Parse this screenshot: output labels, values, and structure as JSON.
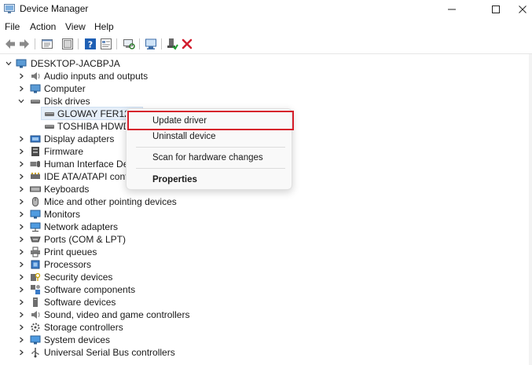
{
  "window": {
    "title": "Device Manager",
    "minimize_icon": "minimize-icon",
    "maximize_icon": "maximize-icon",
    "close_icon": "close-icon"
  },
  "menu": [
    "File",
    "Action",
    "View",
    "Help"
  ],
  "toolbar": {
    "buttons": [
      "back-arrow-icon",
      "forward-arrow-icon",
      "properties-pane-icon",
      "show-hide-console-tree-icon",
      "help-icon",
      "properties-icon",
      "scan-hardware-icon",
      "update-driver-icon",
      "enable-device-icon",
      "uninstall-device-icon"
    ]
  },
  "tree": {
    "root": "DESKTOP-JACBPJA",
    "categories": [
      {
        "label": "Audio inputs and outputs",
        "icon": "speaker-icon"
      },
      {
        "label": "Computer",
        "icon": "monitor-icon"
      },
      {
        "label": "Disk drives",
        "icon": "disk-drive-icon",
        "expanded": true,
        "children": [
          {
            "label": "GLOWAY FER120G",
            "icon": "disk-drive-icon",
            "selected": true
          },
          {
            "label": "TOSHIBA HDWD11",
            "icon": "disk-drive-icon"
          }
        ]
      },
      {
        "label": "Display adapters",
        "icon": "display-adapter-icon"
      },
      {
        "label": "Firmware",
        "icon": "firmware-icon"
      },
      {
        "label": "Human Interface Devic",
        "icon": "hid-icon"
      },
      {
        "label": "IDE ATA/ATAPI control",
        "icon": "ide-controller-icon"
      },
      {
        "label": "Keyboards",
        "icon": "keyboard-icon"
      },
      {
        "label": "Mice and other pointing devices",
        "icon": "mouse-icon"
      },
      {
        "label": "Monitors",
        "icon": "monitor-icon"
      },
      {
        "label": "Network adapters",
        "icon": "network-adapter-icon"
      },
      {
        "label": "Ports (COM & LPT)",
        "icon": "port-icon"
      },
      {
        "label": "Print queues",
        "icon": "printer-icon"
      },
      {
        "label": "Processors",
        "icon": "processor-icon"
      },
      {
        "label": "Security devices",
        "icon": "security-device-icon"
      },
      {
        "label": "Software components",
        "icon": "software-component-icon"
      },
      {
        "label": "Software devices",
        "icon": "software-device-icon"
      },
      {
        "label": "Sound, video and game controllers",
        "icon": "sound-icon"
      },
      {
        "label": "Storage controllers",
        "icon": "storage-controller-icon"
      },
      {
        "label": "System devices",
        "icon": "system-device-icon"
      },
      {
        "label": "Universal Serial Bus controllers",
        "icon": "usb-icon"
      }
    ]
  },
  "context_menu": {
    "items": [
      "Update driver",
      "Uninstall device",
      "Scan for hardware changes",
      "Properties"
    ],
    "highlight_color": "#d61f2b"
  }
}
